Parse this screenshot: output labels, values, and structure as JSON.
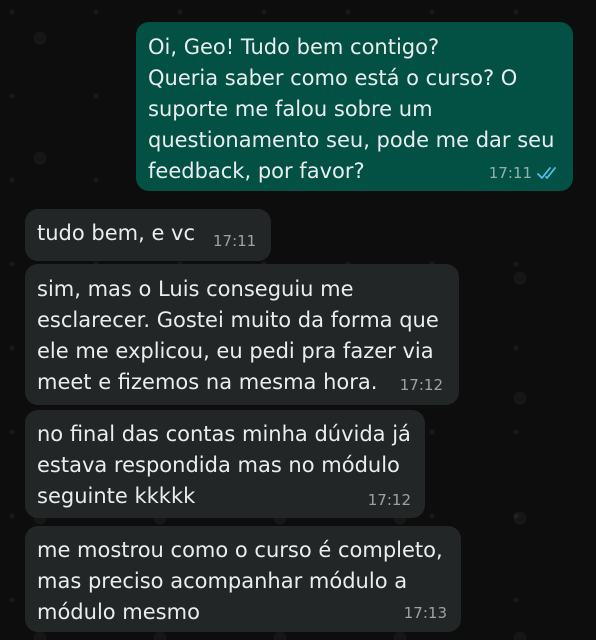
{
  "colors": {
    "outgoing_bubble": "#025144",
    "incoming_bubble": "#232626",
    "text": "#e9edef",
    "read_ticks": "#53bdeb"
  },
  "messages": [
    {
      "direction": "outgoing",
      "text": "Oi, Geo! Tudo bem contigo?\nQueria saber como está o curso? O\nsuporte me falou sobre um\nquestionamento seu, pode me dar seu\nfeedback, por favor?",
      "time": "17:11",
      "status_icon": "double-check-read-icon"
    },
    {
      "direction": "incoming",
      "text": "tudo bem, e vc",
      "time": "17:11"
    },
    {
      "direction": "incoming",
      "text": "sim, mas o Luis conseguiu me\nesclarecer. Gostei muito da forma que\nele me explicou, eu pedi pra fazer via\nmeet e fizemos na mesma hora.",
      "time": "17:12"
    },
    {
      "direction": "incoming",
      "text": "no final das contas minha dúvida já\nestava respondida mas no módulo\nseguinte kkkkk",
      "time": "17:12"
    },
    {
      "direction": "incoming",
      "text": "me mostrou como o curso é completo,\nmas preciso acompanhar módulo a\nmódulo mesmo",
      "time": "17:13"
    }
  ]
}
